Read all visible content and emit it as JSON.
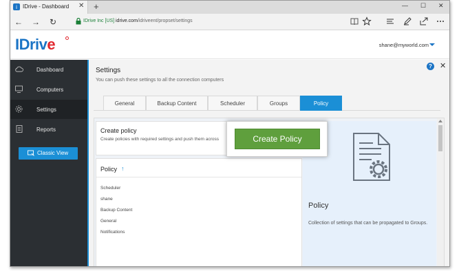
{
  "browser": {
    "tab_title": "IDrive - Dashboard",
    "tab_close": "✕",
    "new_tab": "+",
    "controls": {
      "minimize": "—",
      "maximize": "☐",
      "close": "✕"
    },
    "nav": {
      "back": "←",
      "forward": "→",
      "refresh": "↻"
    },
    "cert_label": "IDrive Inc [US]",
    "url_host": "idrive.com",
    "url_path": "/idriveent/propset/settings"
  },
  "header": {
    "logo_text": "IDriv",
    "logo_e": "e",
    "user_email": "shane@myworld.com"
  },
  "sidebar": {
    "items": [
      {
        "label": "Dashboard",
        "icon": "cloud-icon"
      },
      {
        "label": "Computers",
        "icon": "computer-icon"
      },
      {
        "label": "Settings",
        "icon": "gear-icon",
        "active": true
      },
      {
        "label": "Reports",
        "icon": "report-icon"
      }
    ],
    "classic_view_label": "Classic View"
  },
  "main": {
    "title": "Settings",
    "subtitle": "You can push these settings to all the connection computers",
    "help": "?",
    "close": "✕",
    "tabs": [
      {
        "label": "General"
      },
      {
        "label": "Backup Content"
      },
      {
        "label": "Scheduler"
      },
      {
        "label": "Groups"
      },
      {
        "label": "Policy",
        "active": true
      }
    ],
    "create_policy": {
      "title": "Create policy",
      "description": "Create policies with required settings and push them across"
    },
    "policy_list": {
      "heading": "Policy",
      "sort_arrow": "↑",
      "items": [
        "Scheduler",
        "shane",
        "Backup Content",
        "General",
        "Notifications"
      ]
    },
    "detail": {
      "title": "Policy",
      "description": "Collection of settings that can be propagated to Groups."
    },
    "create_policy_button": "Create Policy"
  },
  "colors": {
    "accent": "#1b8fd6",
    "sidebar_bg": "#2b2f33",
    "button_green": "#5f9f3d",
    "logo_blue": "#1b74c5",
    "logo_red": "#e1262d"
  }
}
